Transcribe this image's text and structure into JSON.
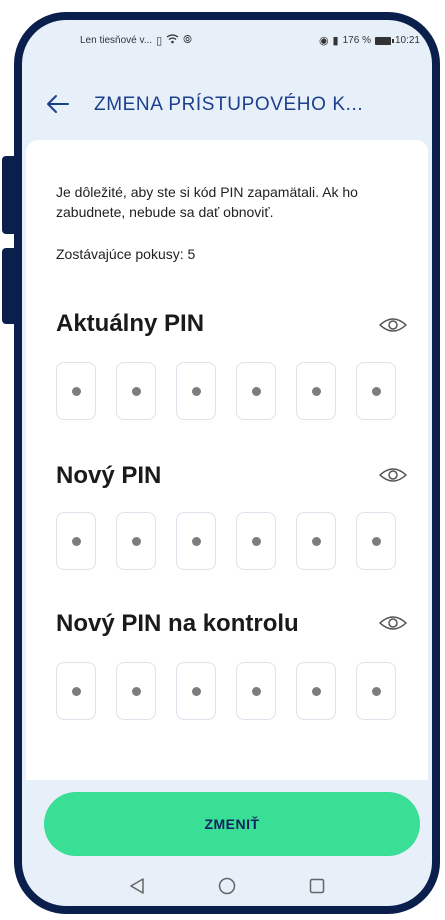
{
  "status_bar": {
    "carrier": "Len tiesňové v...",
    "battery_percent": "176 %",
    "time": "10:21",
    "icons": [
      "sim-icon",
      "wifi-icon",
      "signal-icon",
      "eye-status-icon",
      "vibrate-icon",
      "battery-icon"
    ]
  },
  "header": {
    "title": "ZMENA PRÍSTUPOVÉHO K...",
    "back_icon": "arrow-left-icon"
  },
  "content": {
    "info_text": "Je dôležité, aby ste si kód PIN zapamätali. Ak ho zabudnete, nebude sa dať obnoviť.",
    "attempts_text": "Zostávajúce pokusy: 5"
  },
  "sections": [
    {
      "title": "Aktuálny PIN",
      "digits": 6,
      "visibility_icon": "eye-icon"
    },
    {
      "title": "Nový PIN",
      "digits": 6,
      "visibility_icon": "eye-icon"
    },
    {
      "title": "Nový PIN na kontrolu",
      "digits": 6,
      "visibility_icon": "eye-icon"
    }
  ],
  "button": {
    "label": "ZMENIŤ"
  },
  "navigation": {
    "icons": [
      "back-triangle-icon",
      "home-circle-icon",
      "recents-square-icon"
    ]
  },
  "colors": {
    "frame": "#0b1f4c",
    "accent_blue": "#1c3f8c",
    "button_green": "#39df95",
    "background": "#e7eff9"
  }
}
